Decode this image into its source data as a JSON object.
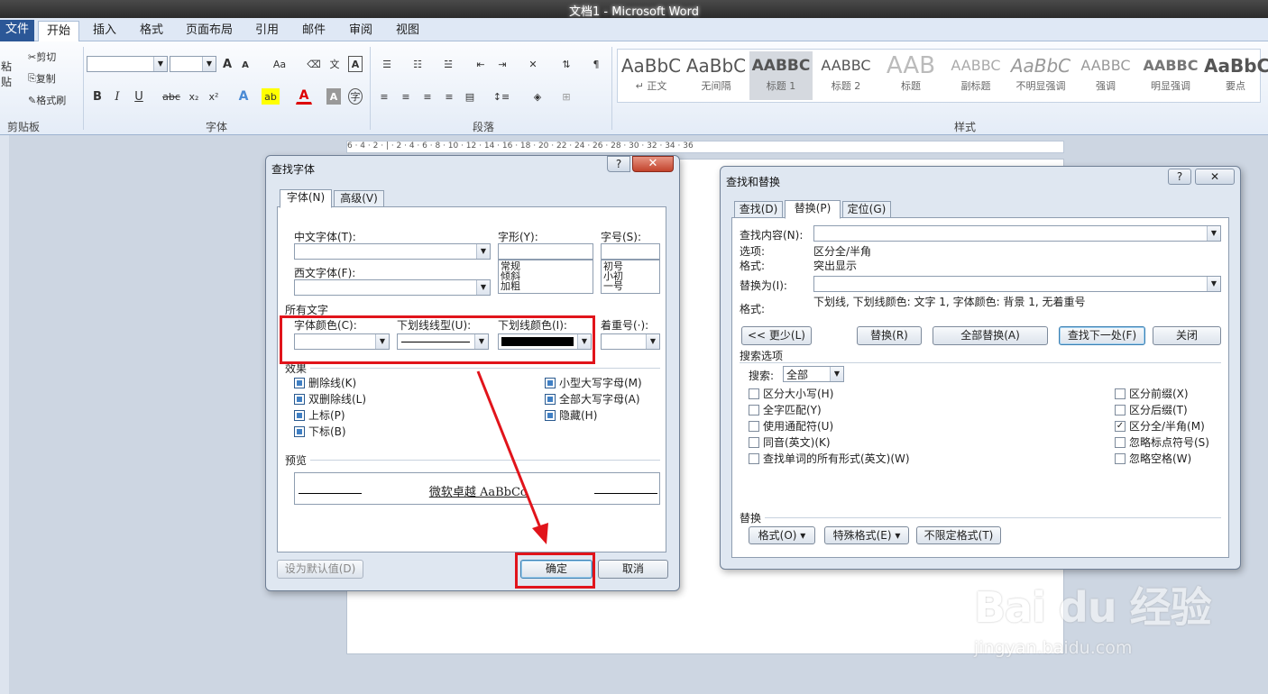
{
  "window": {
    "title": "文档1 - Microsoft Word"
  },
  "ribbon": {
    "tabs": [
      "文件",
      "开始",
      "插入",
      "格式",
      "页面布局",
      "引用",
      "邮件",
      "审阅",
      "视图"
    ],
    "clipboard": {
      "paste": "粘贴",
      "cut": "剪切",
      "copy": "复制",
      "format_painter": "格式刷",
      "label": "剪贴板"
    },
    "font_group": {
      "label": "字体",
      "bold": "B",
      "italic": "I",
      "underline": "U",
      "strike": "abc",
      "sub": "x₂",
      "sup": "x²",
      "grow": "A",
      "shrink": "A",
      "case": "Aa"
    },
    "paragraph_group": {
      "label": "段落"
    },
    "styles_group": {
      "label": "样式",
      "items": [
        {
          "preview": "AaBbC",
          "name": "↵ 正文"
        },
        {
          "preview": "AaBbC",
          "name": "无间隔"
        },
        {
          "preview": "AABBC",
          "name": "标题 1"
        },
        {
          "preview": "AABBC",
          "name": "标题 2"
        },
        {
          "preview": "AAB",
          "name": "标题"
        },
        {
          "preview": "AABBC",
          "name": "副标题"
        },
        {
          "preview": "AaBbC",
          "name": "不明显强调"
        },
        {
          "preview": "AABBC",
          "name": "强调"
        },
        {
          "preview": "AABBC",
          "name": "明显强调"
        },
        {
          "preview": "AaBbC",
          "name": "要点"
        }
      ]
    }
  },
  "ruler": {
    "ticks": "6 · 4 · 2 · | · 2 · 4 · 6 · 8 · 10 · 12 · 14 · 16 · 18 · 20 · 22 · 24 · 26 · 28 · 30 · 32 · 34 · 36"
  },
  "find_font": {
    "title": "查找字体",
    "help": "?",
    "close": "✕",
    "tabs": [
      "字体(N)",
      "高级(V)"
    ],
    "cn_font_label": "中文字体(T):",
    "west_font_label": "西文字体(F):",
    "style_label": "字形(Y):",
    "style_items": [
      "常规",
      "倾斜",
      "加粗"
    ],
    "size_label": "字号(S):",
    "size_items": [
      "初号",
      "小初",
      "一号"
    ],
    "all_text": "所有文字",
    "font_color": "字体颜色(C):",
    "underline_type": "下划线线型(U):",
    "underline_color": "下划线颜色(I):",
    "emphasis": "着重号(·):",
    "effects_title": "效果",
    "effects_left": [
      "删除线(K)",
      "双删除线(L)",
      "上标(P)",
      "下标(B)"
    ],
    "effects_right": [
      "小型大写字母(M)",
      "全部大写字母(A)",
      "隐藏(H)"
    ],
    "preview_title": "预览",
    "preview_text": "微软卓越  AaBbCc",
    "set_default": "设为默认值(D)",
    "ok": "确定",
    "cancel": "取消"
  },
  "find_replace": {
    "title": "查找和替换",
    "help": "?",
    "close": "✕",
    "tabs": [
      "查找(D)",
      "替换(P)",
      "定位(G)"
    ],
    "find_what_label": "查找内容(N):",
    "options_label": "选项:",
    "options_value": "区分全/半角",
    "format_label": "格式:",
    "format_value": "突出显示",
    "replace_with_label": "替换为(I):",
    "replace_format_label": "格式:",
    "replace_format_value": "下划线, 下划线颜色: 文字 1, 字体颜色: 背景 1, 无着重号",
    "less": "<< 更少(L)",
    "replace": "替换(R)",
    "replace_all": "全部替换(A)",
    "find_next": "查找下一处(F)",
    "close_btn": "关闭",
    "search_options": "搜索选项",
    "search_label": "搜索:",
    "search_value": "全部",
    "left_options": [
      "区分大小写(H)",
      "全字匹配(Y)",
      "使用通配符(U)",
      "同音(英文)(K)",
      "查找单词的所有形式(英文)(W)"
    ],
    "right_options": [
      {
        "label": "区分前缀(X)",
        "checked": false
      },
      {
        "label": "区分后缀(T)",
        "checked": false
      },
      {
        "label": "区分全/半角(M)",
        "checked": true
      },
      {
        "label": "忽略标点符号(S)",
        "checked": false
      },
      {
        "label": "忽略空格(W)",
        "checked": false
      }
    ],
    "replace_section": "替换",
    "format_btn": "格式(O) ▾",
    "special_btn": "特殊格式(E) ▾",
    "no_format_btn": "不限定格式(T)"
  },
  "watermark": {
    "brand": "Bai du 经验",
    "url": "jingyan.baidu.com"
  },
  "colors": {
    "annotation": "#e1141b"
  }
}
